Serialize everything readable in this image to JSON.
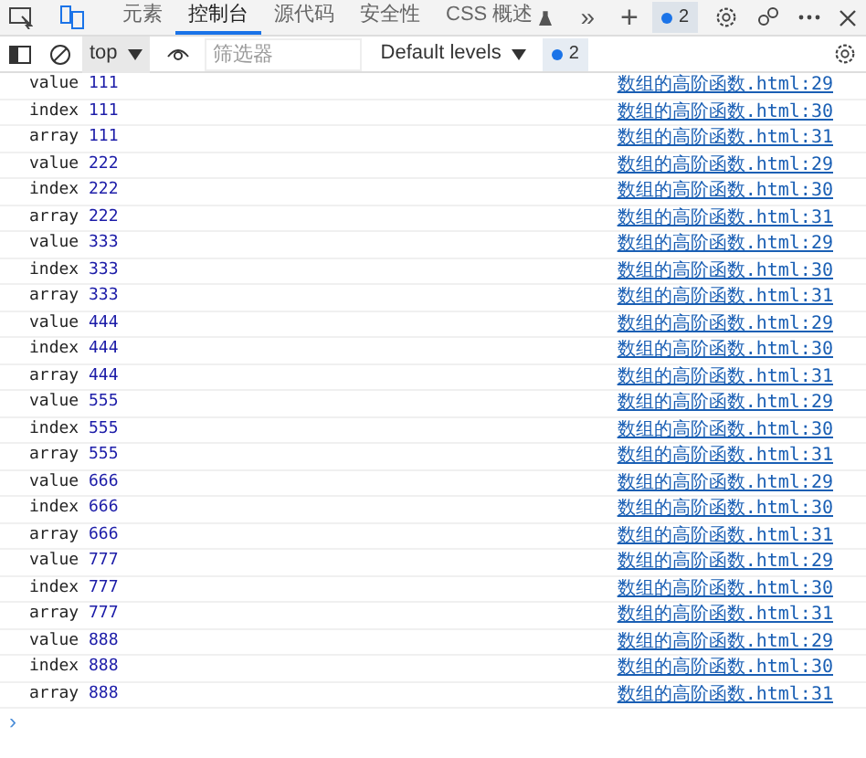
{
  "tabs": [
    {
      "label": "元素",
      "selected": false
    },
    {
      "label": "控制台",
      "selected": true
    },
    {
      "label": "源代码",
      "selected": false
    },
    {
      "label": "安全性",
      "selected": false
    },
    {
      "label": "CSS 概述",
      "selected": false
    }
  ],
  "more_tabs": "»",
  "add_tab": "+",
  "issues_badge": "2",
  "toolbar": {
    "context": "top",
    "filter": {
      "placeholder": "筛选器"
    },
    "levels": "Default levels",
    "issues_badge": "2"
  },
  "logs": [
    {
      "label": "value",
      "value": "111",
      "source": "数组的高阶函数.html:29"
    },
    {
      "label": "index",
      "value": "111",
      "source": "数组的高阶函数.html:30"
    },
    {
      "label": "array",
      "value": "111",
      "source": "数组的高阶函数.html:31"
    },
    {
      "label": "value",
      "value": "222",
      "source": "数组的高阶函数.html:29"
    },
    {
      "label": "index",
      "value": "222",
      "source": "数组的高阶函数.html:30"
    },
    {
      "label": "array",
      "value": "222",
      "source": "数组的高阶函数.html:31"
    },
    {
      "label": "value",
      "value": "333",
      "source": "数组的高阶函数.html:29"
    },
    {
      "label": "index",
      "value": "333",
      "source": "数组的高阶函数.html:30"
    },
    {
      "label": "array",
      "value": "333",
      "source": "数组的高阶函数.html:31"
    },
    {
      "label": "value",
      "value": "444",
      "source": "数组的高阶函数.html:29"
    },
    {
      "label": "index",
      "value": "444",
      "source": "数组的高阶函数.html:30"
    },
    {
      "label": "array",
      "value": "444",
      "source": "数组的高阶函数.html:31"
    },
    {
      "label": "value",
      "value": "555",
      "source": "数组的高阶函数.html:29"
    },
    {
      "label": "index",
      "value": "555",
      "source": "数组的高阶函数.html:30"
    },
    {
      "label": "array",
      "value": "555",
      "source": "数组的高阶函数.html:31"
    },
    {
      "label": "value",
      "value": "666",
      "source": "数组的高阶函数.html:29"
    },
    {
      "label": "index",
      "value": "666",
      "source": "数组的高阶函数.html:30"
    },
    {
      "label": "array",
      "value": "666",
      "source": "数组的高阶函数.html:31"
    },
    {
      "label": "value",
      "value": "777",
      "source": "数组的高阶函数.html:29"
    },
    {
      "label": "index",
      "value": "777",
      "source": "数组的高阶函数.html:30"
    },
    {
      "label": "array",
      "value": "777",
      "source": "数组的高阶函数.html:31"
    },
    {
      "label": "value",
      "value": "888",
      "source": "数组的高阶函数.html:29"
    },
    {
      "label": "index",
      "value": "888",
      "source": "数组的高阶函数.html:30"
    },
    {
      "label": "array",
      "value": "888",
      "source": "数组的高阶函数.html:31"
    }
  ],
  "prompt": "›"
}
